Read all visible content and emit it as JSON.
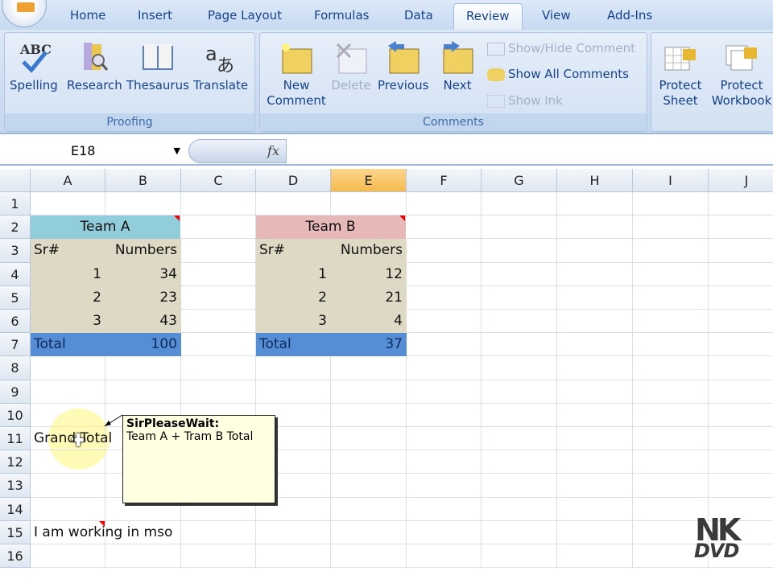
{
  "tabs": [
    "Home",
    "Insert",
    "Page Layout",
    "Formulas",
    "Data",
    "Review",
    "View",
    "Add-Ins"
  ],
  "active_tab": "Review",
  "proofing": {
    "label": "Proofing",
    "buttons": [
      "Spelling",
      "Research",
      "Thesaurus",
      "Translate"
    ]
  },
  "comments": {
    "label": "Comments",
    "new": "New Comment",
    "delete": "Delete",
    "previous": "Previous",
    "next": "Next",
    "show_hide": "Show/Hide Comment",
    "show_all": "Show All Comments",
    "show_ink": "Show Ink"
  },
  "changes": {
    "protect_sheet": "Protect Sheet",
    "protect_workbook": "Protect Workbook"
  },
  "formula_bar": {
    "name_box": "E18",
    "fx": "fx",
    "value": ""
  },
  "columns": [
    "A",
    "B",
    "C",
    "D",
    "E",
    "F",
    "G",
    "H",
    "I",
    "J"
  ],
  "selected_column": "E",
  "rows": [
    "1",
    "2",
    "3",
    "4",
    "5",
    "6",
    "7",
    "8",
    "9",
    "10",
    "11",
    "12",
    "13",
    "14",
    "15",
    "16"
  ],
  "cells": {
    "A2": "Team A",
    "D2": "Team B",
    "A3": "Sr#",
    "B3": "Numbers",
    "D3": "Sr#",
    "E3": "Numbers",
    "A4": "1",
    "B4": "34",
    "D4": "1",
    "E4": "12",
    "A5": "2",
    "B5": "23",
    "D5": "2",
    "E5": "21",
    "A6": "3",
    "B6": "43",
    "D6": "3",
    "E6": "4",
    "A7": "Total",
    "B7": "100",
    "D7": "Total",
    "E7": "37",
    "A11": "Grand Total",
    "A15": "I am working in mso"
  },
  "comment": {
    "author": "SirPleaseWait:",
    "text": "Team A + Tram B Total"
  },
  "colors": {
    "team_a": "#92cddc",
    "team_b": "#e6b8b7",
    "body": "#ddd9c4",
    "total": "#558ed5"
  },
  "logo": {
    "line1": "NK",
    "line2": "DVD"
  }
}
